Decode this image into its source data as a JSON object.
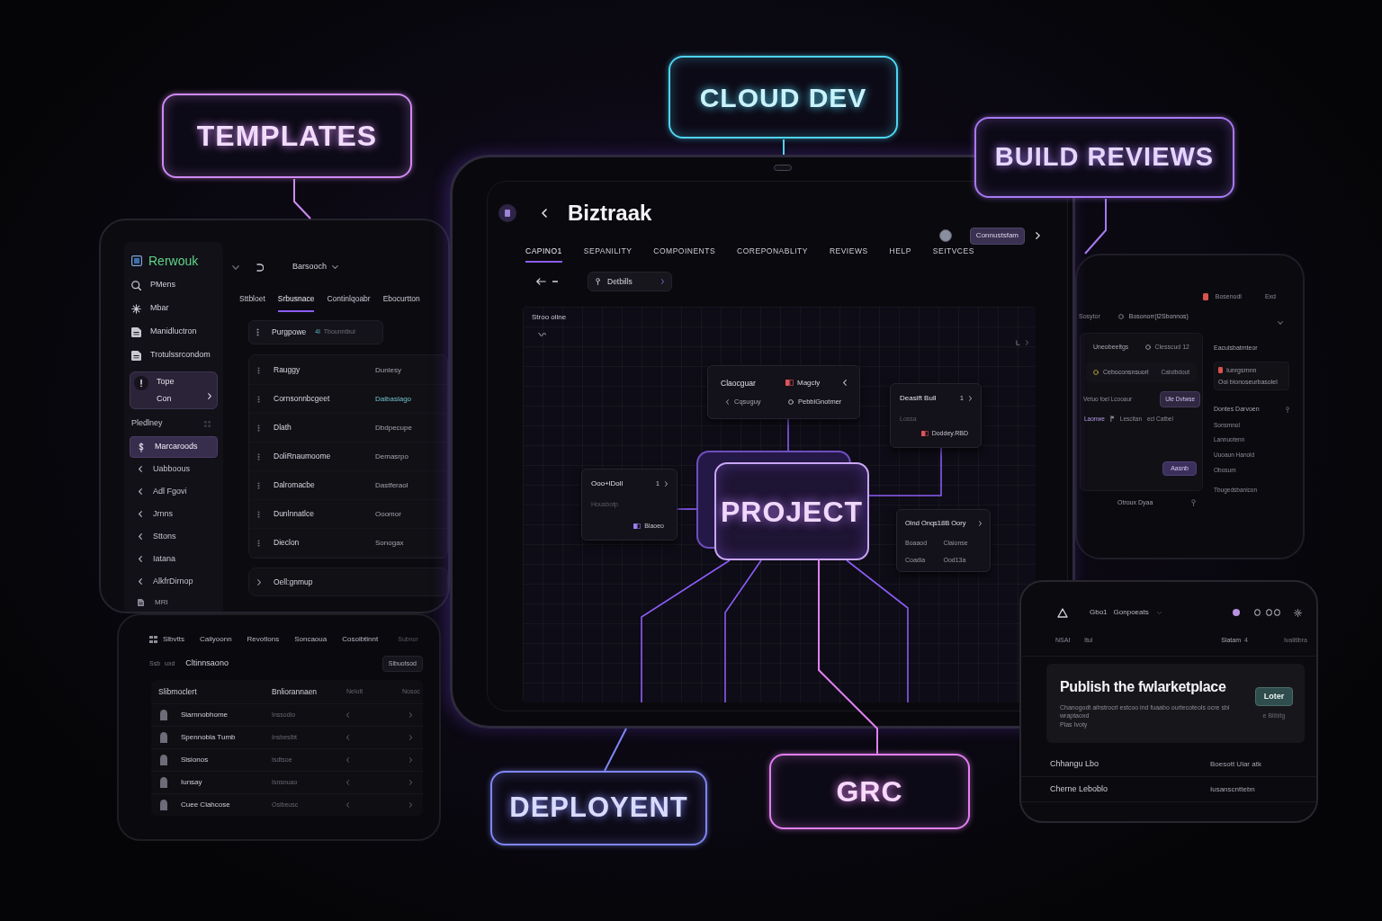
{
  "callouts": [
    {
      "label": "TEMPLATES",
      "color": "#cf8af2"
    },
    {
      "label": "CLOUD DEV",
      "color": "#4fd4f2"
    },
    {
      "label": "BUILD REVIEWS",
      "color": "#a879f2"
    },
    {
      "label": "DEPLOYENT",
      "color": "#7f86f5"
    },
    {
      "label": "GRC",
      "color": "#e27ff0"
    }
  ],
  "left_panel": {
    "brand": "Rerwouk",
    "nav": [
      "PMens",
      "Mbar",
      "Manidluctron",
      "Trotulssrcondom"
    ],
    "card": {
      "title": "Tope",
      "subtitle": "Con"
    },
    "section": "Pledlney",
    "section_items": [
      {
        "label": "Marcaroods",
        "selected": true
      },
      {
        "label": "Uabboous",
        "selected": false
      },
      {
        "label": "Adl Fgovi",
        "selected": false
      },
      {
        "label": "Jrnns",
        "selected": false
      },
      {
        "label": "Sttons",
        "selected": false
      },
      {
        "label": "Iatana",
        "selected": false
      },
      {
        "label": "AlkfrDirnop",
        "selected": false
      }
    ],
    "footer": "MRI",
    "breadcrumb": "Barsooch",
    "tabs": [
      {
        "label": "Sttbloet",
        "selected": false
      },
      {
        "label": "Srbusnace",
        "selected": true
      },
      {
        "label": "Continlqoabr",
        "selected": false
      },
      {
        "label": "Ebocurtton",
        "selected": false
      }
    ],
    "chip": {
      "label": "Purgpowe",
      "count": "4l",
      "value": "Tbounntbul"
    },
    "rows": [
      {
        "name": "Rauggy",
        "value": "Dunlesy",
        "highlighted": false
      },
      {
        "name": "Cornsonnbcgeet",
        "value": "Dalbaslago",
        "highlighted": true
      },
      {
        "name": "Dlath",
        "value": "Dbdpecupe",
        "highlighted": false
      },
      {
        "name": "DoliRnaumoome",
        "value": "Demasrpo",
        "highlighted": false
      },
      {
        "name": "Dalromacbe",
        "value": "Dastferaol",
        "highlighted": false
      },
      {
        "name": "Dunlnnatlce",
        "value": "Ooomor",
        "highlighted": false
      },
      {
        "name": "Dieclon",
        "value": "Sonogax",
        "highlighted": false
      }
    ],
    "group": "Oell:gnmup"
  },
  "main_tablet": {
    "app_name": "Biztraak",
    "account_button": "Connustsfam",
    "tabs": [
      {
        "label": "CAPINO1",
        "selected": true
      },
      {
        "label": "SEPANILITY",
        "selected": false
      },
      {
        "label": "COMPOINENTS",
        "selected": false
      },
      {
        "label": "COREPONABLITY",
        "selected": false
      },
      {
        "label": "REVIEWS",
        "selected": false
      },
      {
        "label": "HELP",
        "selected": false
      },
      {
        "label": "SEITVCES",
        "selected": false
      }
    ],
    "filter": "Detbills",
    "canvas": {
      "title": "Stroo oline",
      "center_node": "PROJECT",
      "nodes": [
        {
          "kind": "summary",
          "title": "Claocguar",
          "tag": "Magcly",
          "items": [
            "Cqsuguy",
            "PebblGnotmer"
          ]
        },
        {
          "kind": "card",
          "title": "Deasift Bull",
          "count": "1",
          "subtitle": "Lossa",
          "tag": "Doddey.RBD"
        },
        {
          "kind": "card",
          "title": "Ooo+lDoll",
          "count": "1",
          "subtitle": "Housbotp",
          "tag": "Blaoeo"
        },
        {
          "kind": "grid",
          "title": "Olnd Onqs18B Oory",
          "cells": [
            "Boaaod",
            "Claionse",
            "Coadia",
            "Ood13a"
          ]
        }
      ]
    }
  },
  "right_panel": {
    "status": "Bosenodl",
    "action": "Exd",
    "path_label": "Sosytor",
    "path": "Bosonorr(l2Sbonnos)",
    "card_title": "Uneobeeltgs",
    "card_badge": "Clesscud 12",
    "item": "Ceboconsnsuorl",
    "item_value": "Catolbdout",
    "prompt": "Vetuo foel Lcooaur",
    "prompt_button": "Ule Dvtwse",
    "meta": [
      "Laonwe",
      "Lescitan",
      "ecl Catbel"
    ],
    "submit_button": "Aasnb",
    "footer": "Otroux Dyaa",
    "side_title": "Eaculsbatmteor",
    "notice_title": "Iunrgsrnnn",
    "notice_text": "Ooi bionoseurbasolel",
    "list_title": "Dontes Darvoen",
    "list": [
      "Sonsmnol",
      "Lannuotenn",
      "Uuoaun Hanold",
      "Obosum",
      "Tbugedsbanicon"
    ]
  },
  "bottom_left_panel": {
    "nav": [
      "Slbvtts",
      "Cailyoonn",
      "Revotlons",
      "Soncaoua",
      "Cosoibtinnt",
      "Subnor"
    ],
    "filter": [
      "Ssb",
      "uxd"
    ],
    "title": "Cltinnsaono",
    "button": "Sibuotsod",
    "columns": [
      "Slibrnoclert",
      "Bnliorannaen",
      "Nelutt",
      "Nosoc"
    ],
    "rows": [
      {
        "name": "Siarnnobhome",
        "detail": "Inssodio"
      },
      {
        "name": "Spennobla Tumb",
        "detail": "Insbeslbt"
      },
      {
        "name": "Sisionos",
        "detail": "Isdtsoe"
      },
      {
        "name": "Iunsay",
        "detail": "Isnsnuao"
      },
      {
        "name": "Cuee Clahcose",
        "detail": "Osibeusc"
      }
    ]
  },
  "bottom_right_panel": {
    "title": "Gbo1",
    "subtitle": "Gonpoeats",
    "tabs": [
      "NSAI",
      "ltul"
    ],
    "status": "Slatam",
    "status_count": "4",
    "meta": "Ivalitlbra",
    "banner": {
      "title": "Publish the fwlarketplace",
      "text": "Chanogodt aihstrocrl estcoo ind fuaabo ourtecoteols ocre sbi wraptaoxd",
      "note": "Plas Ivoty",
      "button": "Loter",
      "secondary": "e Blibitg"
    },
    "rows": [
      {
        "label": "Chhangu Lbo",
        "value": "Boesott Ular atk"
      },
      {
        "label": "Cherne Leboblo",
        "value": "Iusanscnttebn"
      }
    ]
  }
}
